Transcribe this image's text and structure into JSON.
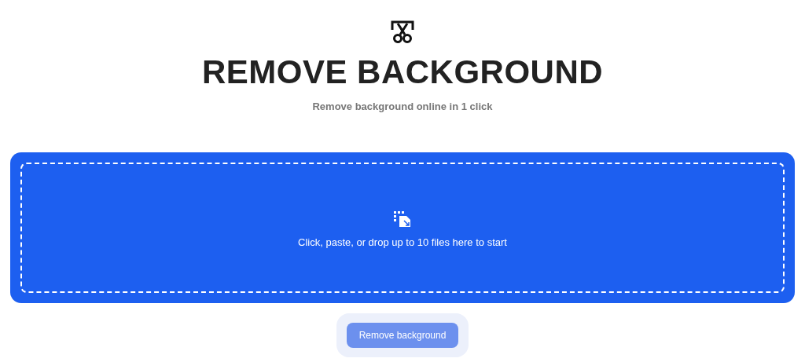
{
  "header": {
    "title": "REMOVE BACKGROUND",
    "subtitle": "Remove background online in 1 click"
  },
  "dropzone": {
    "prompt": "Click, paste, or drop up to 10 files here to start"
  },
  "action_button": {
    "label": "Remove background",
    "disabled": true
  }
}
